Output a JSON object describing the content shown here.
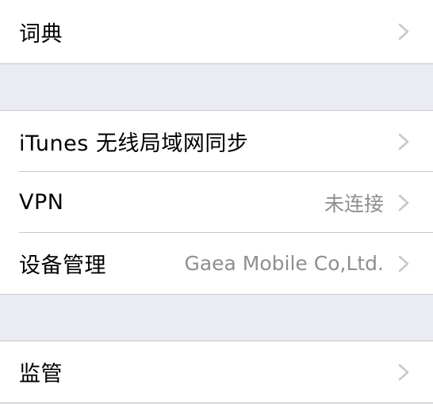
{
  "settings": {
    "rows": [
      {
        "label": "词典",
        "detail": ""
      },
      {
        "label": "iTunes 无线局域网同步",
        "detail": ""
      },
      {
        "label": "VPN",
        "detail": "未连接"
      },
      {
        "label": "设备管理",
        "detail": "Gaea Mobile Co,Ltd."
      },
      {
        "label": "监管",
        "detail": ""
      }
    ],
    "chevron_icon": "chevron-right-icon",
    "colors": {
      "group_background": "#ebebf3",
      "cell_background": "#ffffff",
      "separator": "#c8c7cc",
      "detail_text": "#8e8e93",
      "chevron": "#c7c7cc"
    }
  }
}
